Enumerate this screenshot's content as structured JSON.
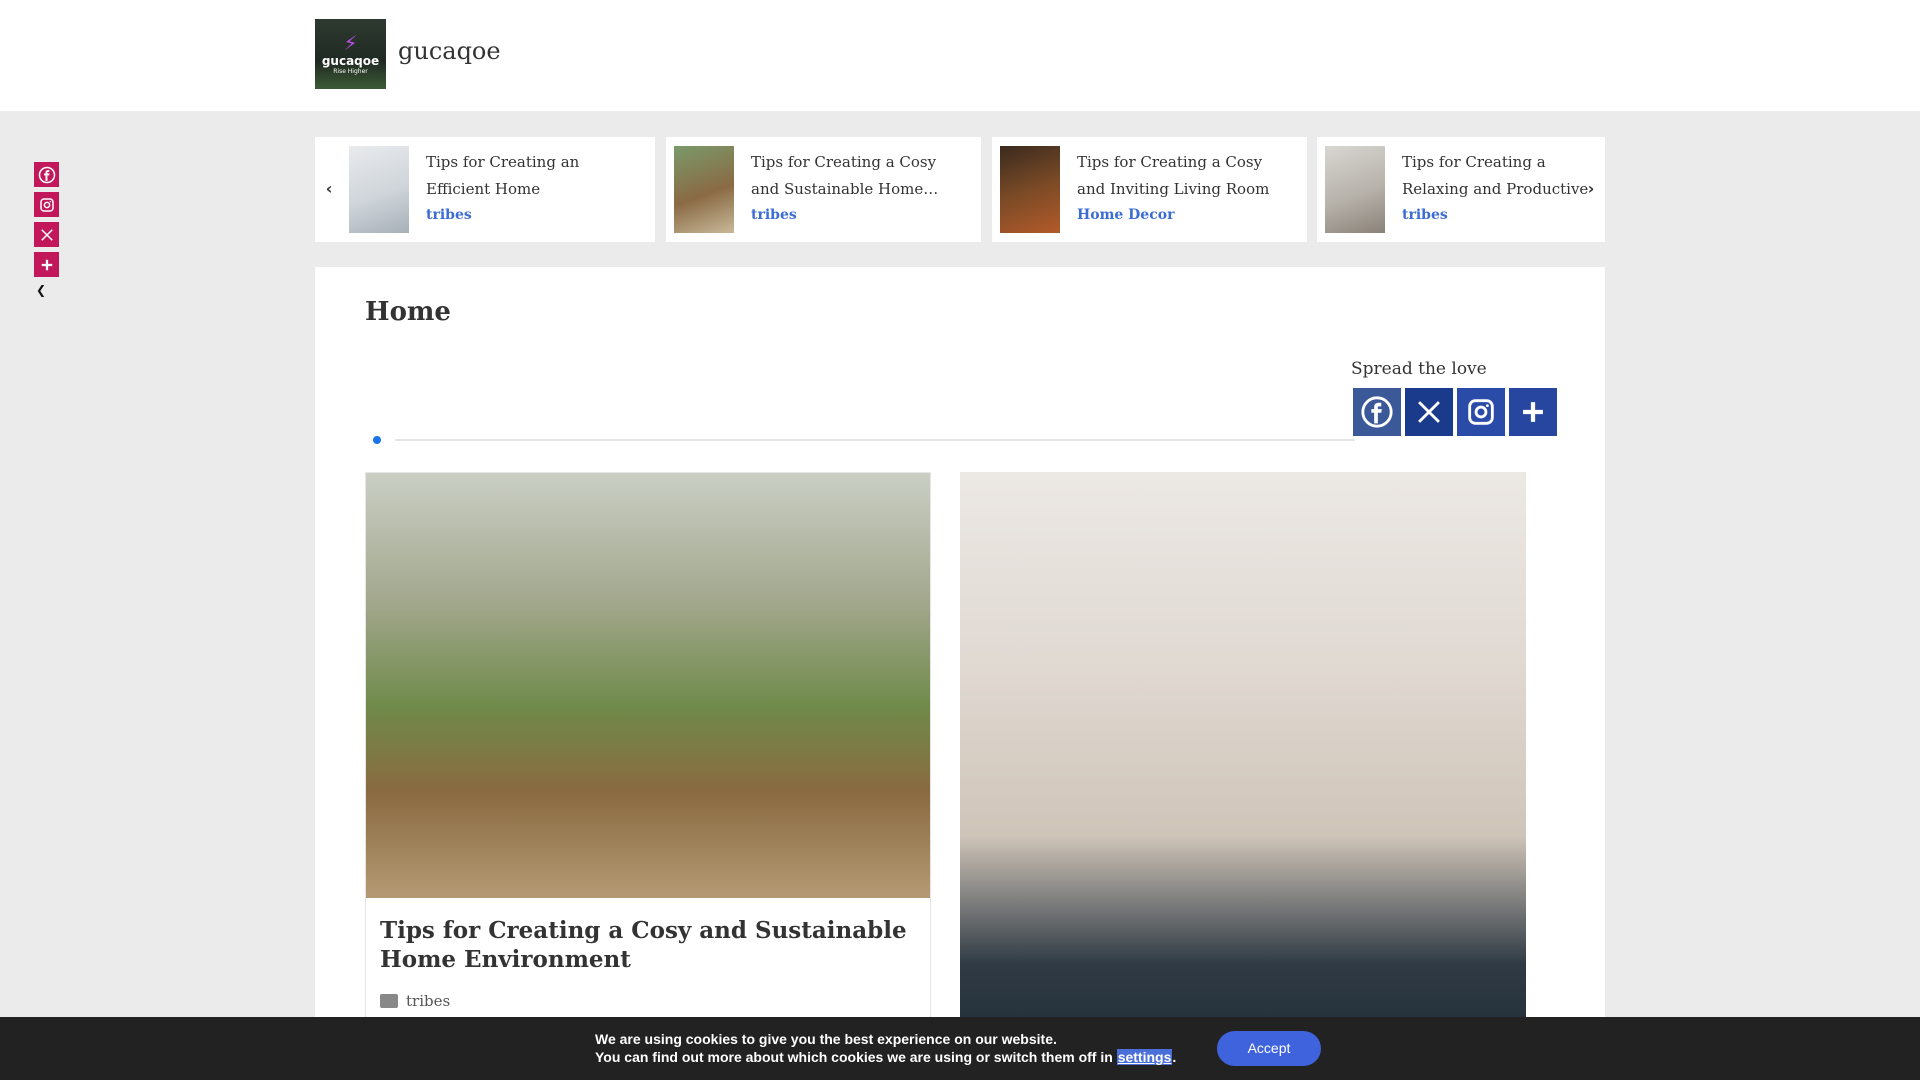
{
  "site": {
    "title": "gucaqoe",
    "logo_word": "gucaqoe",
    "logo_tagline": "Rise Higher"
  },
  "float_share": {
    "items": [
      "facebook-icon",
      "instagram-icon",
      "x-icon",
      "plus-icon"
    ],
    "hide_icon": "chevron-left-icon"
  },
  "carousel": {
    "items": [
      {
        "title": "Tips for Creating an Efficient Home Workspace…",
        "category": "tribes"
      },
      {
        "title": "Tips for Creating a Cosy and Sustainable Home…",
        "category": "tribes"
      },
      {
        "title": "Tips for Creating a Cosy and Inviting Living Room Spac…",
        "category": "Home Decor"
      },
      {
        "title": "Tips for Creating a Relaxing and Productive Home Of…",
        "category": "tribes"
      }
    ]
  },
  "main": {
    "page_title": "Home",
    "spread_label": "Spread the love",
    "share_buttons": [
      {
        "icon": "facebook-icon",
        "color": "#3b5998"
      },
      {
        "icon": "x-icon",
        "color": "#1a3a8c"
      },
      {
        "icon": "instagram-icon",
        "color": "#2a4ba8"
      },
      {
        "icon": "plus-icon",
        "color": "#2646a0"
      }
    ],
    "posts": [
      {
        "title": "Tips for Creating a Cosy and Sustainable Home Environment",
        "category": "tribes"
      },
      {
        "title": "",
        "category": ""
      }
    ]
  },
  "cookie": {
    "line1": "We are using cookies to give you the best experience on our website.",
    "line2_prefix": "You can find out more about which cookies we are using or switch them off in",
    "link": "settings",
    "line2_suffix": ".",
    "accept": "Accept"
  }
}
